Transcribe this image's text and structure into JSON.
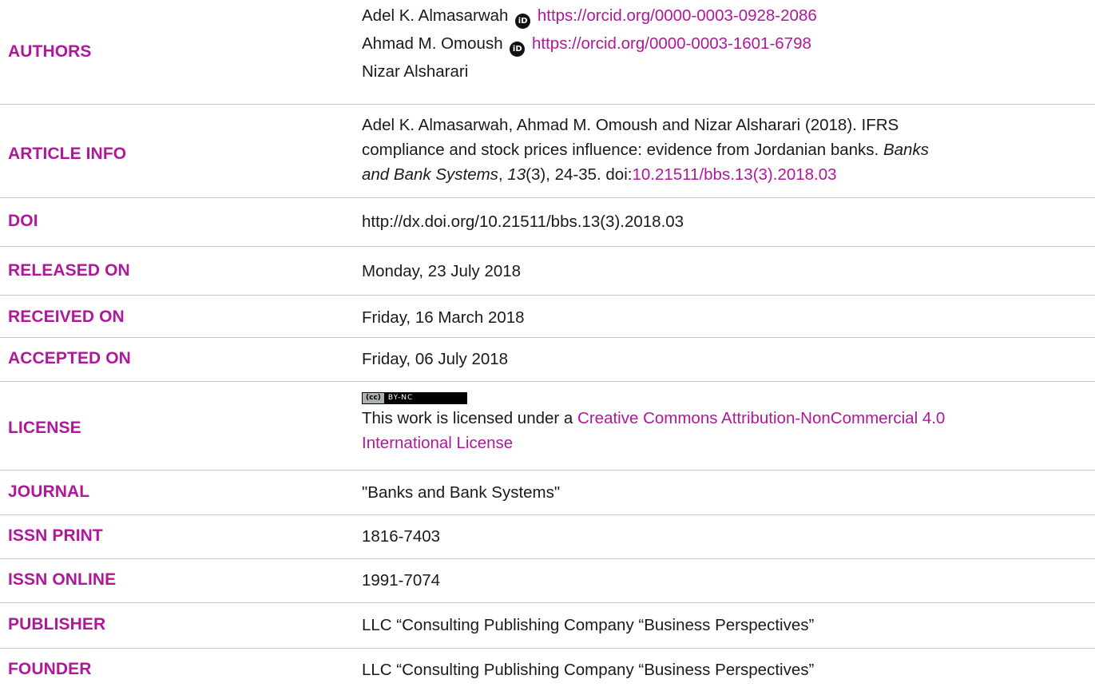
{
  "colors": {
    "label": "#b0189a",
    "link": "#b0189a",
    "text": "#1a1a1a",
    "divider": "#c9c9c9"
  },
  "authors": {
    "label": "AUTHORS",
    "list": [
      {
        "name": "Adel K. Almasarwah",
        "orcid_icon": "orcid-icon",
        "orcid": "https://orcid.org/0000-0003-0928-2086"
      },
      {
        "name": "Ahmad M. Omoush",
        "orcid_icon": "orcid-icon",
        "orcid": "https://orcid.org/0000-0003-1601-6798"
      },
      {
        "name": "Nizar Alsharari"
      }
    ]
  },
  "article_info": {
    "label": "ARTICLE INFO",
    "line1": "Adel K. Almasarwah, Ahmad M. Omoush and Nizar Alsharari (2018). IFRS",
    "line2_a": "compliance and stock prices influence: evidence from Jordanian banks. ",
    "line2_b": "Banks",
    "line3_a": "and Bank Systems",
    "line3_b": ", ",
    "line3_c": "13",
    "line3_d": "(3), 24-35. doi:",
    "line3_doi": "10.21511/bbs.13(3).2018.03"
  },
  "doi": {
    "label": "DOI",
    "value": "http://dx.doi.org/10.21511/bbs.13(3).2018.03"
  },
  "released_on": {
    "label": "RELEASED ON",
    "value": "Monday, 23 July 2018"
  },
  "received_on": {
    "label": "RECEIVED ON",
    "value": "Friday, 16 March 2018"
  },
  "accepted_on": {
    "label": "ACCEPTED ON",
    "value": "Friday, 06 July 2018"
  },
  "license": {
    "label": "LICENSE",
    "badge_cc": "(cc)",
    "badge_terms": "BY-NC",
    "text": "This work is licensed under a ",
    "link_line1": "Creative Commons Attribution-NonCommercial 4.0",
    "link_line2": "International License"
  },
  "journal": {
    "label": "JOURNAL",
    "value": "\"Banks and Bank Systems\""
  },
  "issn_print": {
    "label": "ISSN PRINT",
    "value": "1816-7403"
  },
  "issn_online": {
    "label": "ISSN ONLINE",
    "value": "1991-7074"
  },
  "publisher": {
    "label": "PUBLISHER",
    "value": "LLC “Consulting Publishing Company “Business Perspectives”"
  },
  "founder": {
    "label": "FOUNDER",
    "value": "LLC “Consulting Publishing Company “Business Perspectives”"
  }
}
